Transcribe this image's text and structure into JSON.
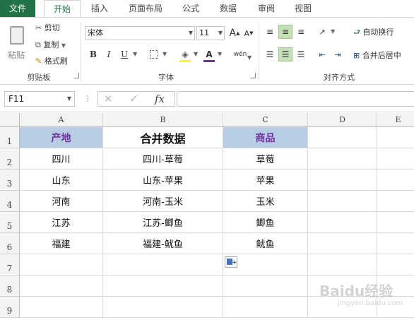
{
  "tabs": [
    "文件",
    "开始",
    "插入",
    "页面布局",
    "公式",
    "数据",
    "审阅",
    "视图"
  ],
  "clipboard": {
    "paste_label": "粘贴",
    "cut_label": "剪切",
    "copy_label": "复制",
    "format_painter_label": "格式刷",
    "group_label": "剪贴板"
  },
  "font": {
    "font_name": "宋体",
    "font_size": "11",
    "grow_label": "A",
    "shrink_label": "A",
    "bold_label": "B",
    "italic_label": "I",
    "underline_label": "U",
    "font_color_label": "A",
    "phonetic_label": "wén",
    "group_label": "字体"
  },
  "alignment": {
    "wrap_text_label": "自动换行",
    "merge_center_label": "合并后居中",
    "group_label": "对齐方式"
  },
  "formula_bar": {
    "name_box": "F11",
    "fx_label": "fx",
    "cancel_label": "✕",
    "enter_label": "✓",
    "value": ""
  },
  "columns": [
    "A",
    "B",
    "C",
    "D",
    "E"
  ],
  "rows": [
    "1",
    "2",
    "3",
    "4",
    "5",
    "6",
    "7",
    "8",
    "9"
  ],
  "cells": {
    "a1": "产地",
    "b1": "合并数据",
    "c1": "商品",
    "a2": "四川",
    "b2": "四川-草莓",
    "c2": "草莓",
    "a3": "山东",
    "b3": "山东-苹果",
    "c3": "苹果",
    "a4": "河南",
    "b4": "河南-玉米",
    "c4": "玉米",
    "a5": "江苏",
    "b5": "江苏-鲫鱼",
    "c5": "鲫鱼",
    "a6": "福建",
    "b6": "福建-鱿鱼",
    "c6": "鱿鱼"
  },
  "watermark": {
    "text": "Baidu经验",
    "subtext": "jingyan.baidu.com"
  },
  "colors": {
    "accent": "#217346",
    "header_fill": "#b8cce4",
    "header_text": "#7030a0",
    "align_highlight": "#c5e0b4"
  }
}
